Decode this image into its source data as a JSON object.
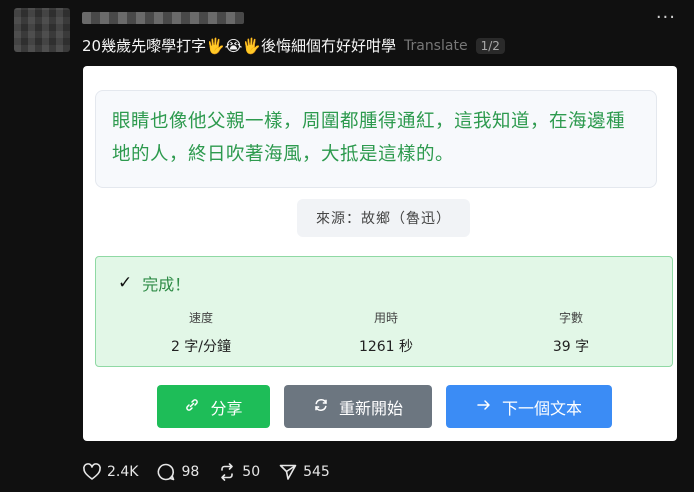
{
  "post": {
    "text": "20幾歲先嚟學打字🖐️😭🖐️後悔細個冇好好咁學",
    "translate_label": "Translate",
    "page_indicator": "1/2",
    "more_icon": "more-horizontal-icon"
  },
  "card": {
    "quote": "眼睛也像他父親一樣，周圍都腫得通紅，這我知道，在海邊種地的人，終日吹著海風，大抵是這樣的。",
    "source": "來源：故鄉（魯迅）",
    "result": {
      "status_icon": "check-icon",
      "status": "完成！",
      "stats": [
        {
          "label": "速度",
          "value": "2 字/分鐘"
        },
        {
          "label": "用時",
          "value": "1261 秒"
        },
        {
          "label": "字數",
          "value": "39 字"
        }
      ]
    },
    "buttons": {
      "share": "分享",
      "restart": "重新開始",
      "next": "下一個文本"
    }
  },
  "actions": {
    "likes": "2.4K",
    "comments": "98",
    "reposts": "50",
    "shares": "545"
  },
  "colors": {
    "background": "#101010",
    "quote_text": "#2d9a4e",
    "share_button": "#1ebd58",
    "restart_button": "#6c7680",
    "next_button": "#3b8cf5",
    "result_bg": "#e2f7e7"
  }
}
